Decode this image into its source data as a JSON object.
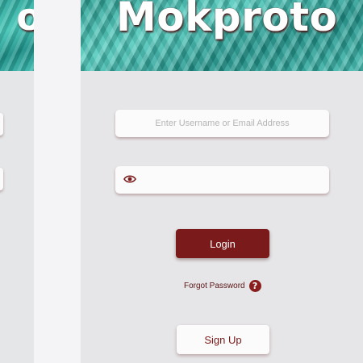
{
  "left_screen": {
    "banner_title_fragment": "o"
  },
  "app": {
    "title": "Mokproto"
  },
  "login_form": {
    "username": {
      "placeholder": "Enter Username or Email Address",
      "value": ""
    },
    "password": {
      "value": "",
      "icon": "eye-icon"
    },
    "login_label": "Login",
    "forgot_password_label": "Forgot Password",
    "help_icon": "question-circle-icon",
    "help_glyph": "?",
    "signup_label": "Sign Up"
  },
  "colors": {
    "primary": "#7b1a1a",
    "banner": "#3ab5aa",
    "background": "#e6e6e8"
  }
}
